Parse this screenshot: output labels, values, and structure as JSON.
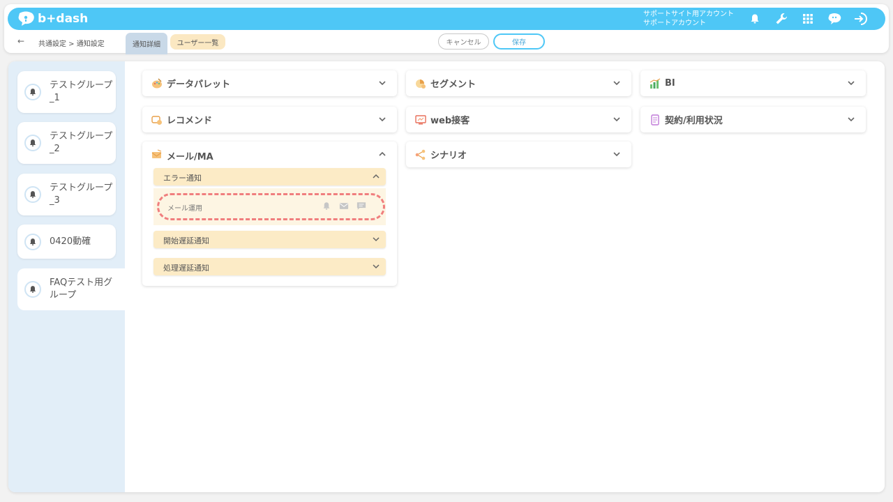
{
  "app": {
    "logo_text": "b+dash"
  },
  "account": {
    "line1": "サポートサイト用アカウント",
    "line2": "サポートアカウント"
  },
  "header_icons": [
    "bell-icon",
    "wrench-icon",
    "grid-icon",
    "assistant-icon",
    "logout-icon"
  ],
  "subbar": {
    "back": "←",
    "breadcrumb": "共通設定 > 通知設定",
    "tabs": [
      {
        "label": "通知詳細",
        "active": true
      },
      {
        "label": "ユーザー一覧",
        "active": false
      }
    ],
    "cancel_label": "キャンセル",
    "save_label": "保存"
  },
  "sidebar": {
    "items": [
      {
        "label": "テストグループ_1"
      },
      {
        "label": "テストグループ_2"
      },
      {
        "label": "テストグループ_3"
      },
      {
        "label": "0420動確"
      },
      {
        "label": "FAQテスト用グループ",
        "active": true
      }
    ]
  },
  "categories": [
    {
      "label": "データパレット",
      "icon": "palette-icon",
      "expanded": false
    },
    {
      "label": "セグメント",
      "icon": "segment-icon",
      "expanded": false
    },
    {
      "label": "BI",
      "icon": "bi-chart-icon",
      "expanded": false
    },
    {
      "label": "レコメンド",
      "icon": "recommend-icon",
      "expanded": false
    },
    {
      "label": "web接客",
      "icon": "web-icon",
      "expanded": false
    },
    {
      "label": "契約/利用状況",
      "icon": "contract-icon",
      "expanded": false
    },
    {
      "label": "シナリオ",
      "icon": "scenario-icon",
      "expanded": false
    }
  ],
  "mail": {
    "label": "メール/MA",
    "expanded": true,
    "sub_sections": [
      {
        "label": "エラー通知",
        "expanded": true
      },
      {
        "label": "開始遅延通知",
        "expanded": false
      },
      {
        "label": "処理遅延通知",
        "expanded": false
      }
    ],
    "row": {
      "label": "メール運用"
    }
  },
  "colors": {
    "accent": "#4ec7f6",
    "sub_header": "#fcebc6",
    "sidebar_bg": "#e2eef8",
    "highlight": "#f07e7e"
  }
}
